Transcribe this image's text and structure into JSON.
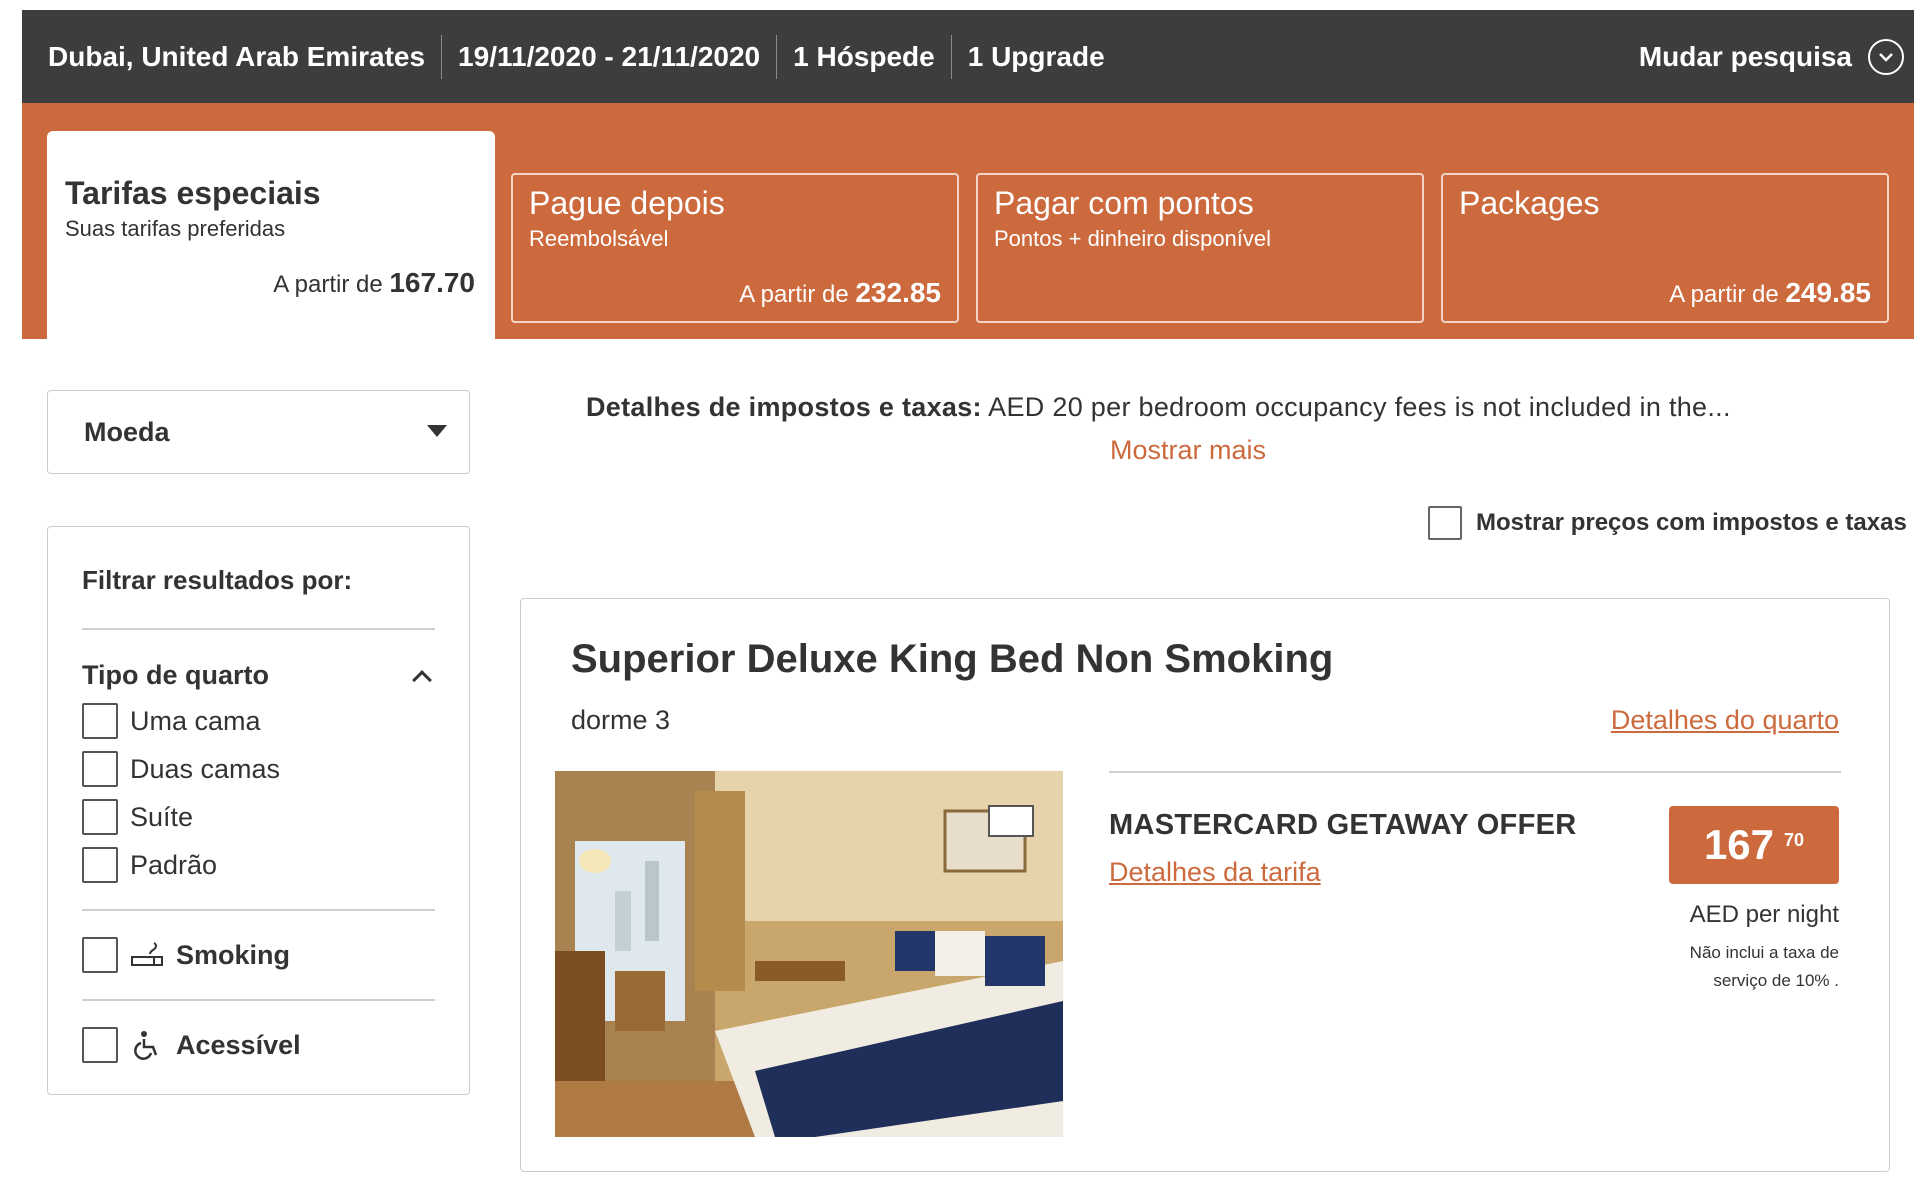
{
  "search": {
    "location": "Dubai, United Arab Emirates",
    "dates": "19/11/2020 - 21/11/2020",
    "guests": "1 Hóspede",
    "upgrade": "1 Upgrade",
    "change_label": "Mudar pesquisa"
  },
  "rate_tabs": [
    {
      "title": "Tarifas especiais",
      "subtitle": "Suas tarifas preferidas",
      "price_prefix": "A partir de",
      "price": "167.70",
      "active": true
    },
    {
      "title": "Pague depois",
      "subtitle": "Reembolsável",
      "price_prefix": "A partir de",
      "price": "232.85",
      "active": false
    },
    {
      "title": "Pagar com pontos",
      "subtitle": "Pontos + dinheiro disponível",
      "price_prefix": "",
      "price": "",
      "active": false
    },
    {
      "title": "Packages",
      "subtitle": "",
      "price_prefix": "A partir de",
      "price": "249.85",
      "active": false
    }
  ],
  "sidebar": {
    "currency_label": "Moeda",
    "filter_title": "Filtrar resultados por:",
    "room_type_heading": "Tipo de quarto",
    "room_types": [
      "Uma cama",
      "Duas camas",
      "Suíte",
      "Padrão"
    ],
    "smoking_label": "Smoking",
    "accessible_label": "Acessível"
  },
  "taxes": {
    "label": "Detalhes de impostos e taxas:",
    "text": "AED 20 per bedroom occupancy fees is not included in the...",
    "show_more": "Mostrar mais",
    "toggle_label": "Mostrar preços com impostos e taxas"
  },
  "room": {
    "name": "Superior Deluxe King Bed Non Smoking",
    "sleeps": "dorme 3",
    "details_link": "Detalhes do quarto",
    "rate_name": "MASTERCARD GETAWAY OFFER",
    "rate_details_link": "Detalhes da tarifa",
    "price_whole": "167",
    "price_cents": "70",
    "per_night": "AED per night",
    "service_note": "Não inclui a taxa de serviço de 10% ."
  },
  "colors": {
    "accent": "#cc6a3d",
    "header_bg": "#3d3d3d"
  }
}
